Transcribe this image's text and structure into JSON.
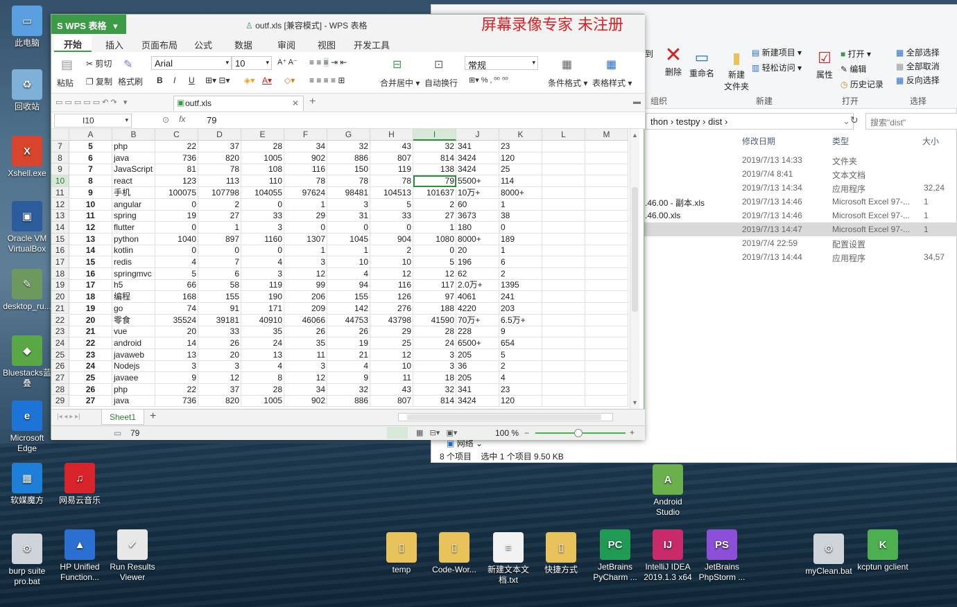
{
  "desktop": {
    "icons": [
      {
        "label": "此电脑",
        "color": "#5aa0e0",
        "glyph": "▭"
      },
      {
        "label": "回收站",
        "color": "#7fb0d8",
        "glyph": "♻"
      },
      {
        "label": "Xshell.exe",
        "color": "#d9442c",
        "glyph": "X"
      },
      {
        "label": "Oracle VM VirtualBox",
        "color": "#2b5d9c",
        "glyph": "▣"
      },
      {
        "label": "desktop_ru...",
        "color": "#6c9a5e",
        "glyph": "✎"
      },
      {
        "label": "Bluestacks蓝叠",
        "color": "#5aa845",
        "glyph": "◆"
      },
      {
        "label": "Microsoft Edge",
        "color": "#1b74d6",
        "glyph": "e"
      },
      {
        "label": "软媒魔方",
        "color": "#1e7fd8",
        "glyph": "▦"
      },
      {
        "label": "网易云音乐",
        "color": "#d8232a",
        "glyph": "♫"
      },
      {
        "label": "burp suite pro.bat",
        "color": "#cfd4da",
        "glyph": "⚙"
      },
      {
        "label": "HP Unified Function...",
        "color": "#2a6fd1",
        "glyph": "▲"
      },
      {
        "label": "Run Results Viewer",
        "color": "#e8e8e8",
        "glyph": "✔"
      },
      {
        "label": "temp",
        "color": "#e8c25a",
        "glyph": "▯"
      },
      {
        "label": "Code-Wor...",
        "color": "#e8c25a",
        "glyph": "▯"
      },
      {
        "label": "新建文本文档.txt",
        "color": "#f2f2f2",
        "glyph": "≡"
      },
      {
        "label": "快捷方式",
        "color": "#e8c25a",
        "glyph": "▯"
      },
      {
        "label": "JetBrains PyCharm ...",
        "color": "#1f9b53",
        "glyph": "PC"
      },
      {
        "label": "IntelliJ IDEA 2019.1.3 x64",
        "color": "#c92a69",
        "glyph": "IJ"
      },
      {
        "label": "JetBrains PhpStorm ...",
        "color": "#8b4fd8",
        "glyph": "PS"
      },
      {
        "label": "Android Studio",
        "color": "#6ab04c",
        "glyph": "A"
      },
      {
        "label": "myClean.bat",
        "color": "#cfd4da",
        "glyph": "⚙"
      },
      {
        "label": "kcptun gclient",
        "color": "#4caf50",
        "glyph": "K"
      }
    ]
  },
  "explorer": {
    "ribbon": {
      "move_to": "到",
      "delete": "删除",
      "rename": "重命名",
      "new_folder": "新建\n文件夹",
      "new_item": "新建项目",
      "easy_access": "轻松访问",
      "properties": "属性",
      "open": "打开",
      "edit": "编辑",
      "history": "历史记录",
      "select_all": "全部选择",
      "select_none": "全部取消",
      "invert": "反向选择",
      "groups": {
        "organize": "组织",
        "new": "新建",
        "open": "打开",
        "select": "选择"
      }
    },
    "address": {
      "parts": [
        "thon",
        "testpy",
        "dist"
      ]
    },
    "search_placeholder": "搜索\"dist\"",
    "columns": {
      "date": "修改日期",
      "type": "类型",
      "size": "大小"
    },
    "files": [
      {
        "name": "",
        "date": "2019/7/13 14:33",
        "type": "文件夹",
        "size": ""
      },
      {
        "name": "",
        "date": "2019/7/4 8:41",
        "type": "文本文档",
        "size": ""
      },
      {
        "name": "",
        "date": "2019/7/13 14:34",
        "type": "应用程序",
        "size": "32,24"
      },
      {
        "name": ".46.00 - 副本.xls",
        "date": "2019/7/13 14:46",
        "type": "Microsoft Excel 97-...",
        "size": "1"
      },
      {
        "name": ".46.00.xls",
        "date": "2019/7/13 14:46",
        "type": "Microsoft Excel 97-...",
        "size": "1"
      },
      {
        "name": "",
        "date": "2019/7/13 14:47",
        "type": "Microsoft Excel 97-...",
        "size": "1"
      },
      {
        "name": "",
        "date": "2019/7/4 22:59",
        "type": "配置设置",
        "size": ""
      },
      {
        "name": "",
        "date": "2019/7/13 14:44",
        "type": "应用程序",
        "size": "34,57"
      }
    ],
    "nav_network": "网络",
    "status": {
      "count": "8 个项目",
      "selected": "选中 1 个项目  9.50 KB"
    }
  },
  "wps": {
    "app_name": "WPS 表格",
    "title": "outf.xls [兼容模式] - WPS 表格",
    "watermark": "屏幕录像专家  未注册",
    "menus": [
      "开始",
      "插入",
      "页面布局",
      "公式",
      "数据",
      "审阅",
      "视图",
      "开发工具"
    ],
    "toolbar": {
      "cut": "剪切",
      "paste": "粘贴",
      "copy": "复制",
      "format_painter": "格式刷",
      "font": "Arial",
      "size": "10",
      "merge": "合并居中",
      "wrap": "自动换行",
      "number_format": "常规",
      "cond_format": "条件格式",
      "table_style": "表格样式"
    },
    "doc_tab": "outf.xls",
    "name_box": "I10",
    "fx": "fx",
    "formula_value": "79",
    "columns": [
      "A",
      "B",
      "C",
      "D",
      "E",
      "F",
      "G",
      "H",
      "I",
      "J",
      "K",
      "L",
      "M"
    ],
    "rows": [
      {
        "r": "7",
        "c": [
          "5",
          "php",
          "22",
          "37",
          "28",
          "34",
          "32",
          "43",
          "32",
          "341",
          "23"
        ]
      },
      {
        "r": "8",
        "c": [
          "6",
          "java",
          "736",
          "820",
          "1005",
          "902",
          "886",
          "807",
          "814",
          "3424",
          "120"
        ]
      },
      {
        "r": "9",
        "c": [
          "7",
          "JavaScript",
          "81",
          "78",
          "108",
          "116",
          "150",
          "119",
          "138",
          "3424",
          "25"
        ]
      },
      {
        "r": "10",
        "c": [
          "8",
          "react",
          "123",
          "113",
          "110",
          "78",
          "78",
          "78",
          "79",
          "5500+",
          "114"
        ]
      },
      {
        "r": "11",
        "c": [
          "9",
          "手机",
          "100075",
          "107798",
          "104055",
          "97624",
          "98481",
          "104513",
          "101637",
          "10万+",
          "8000+"
        ]
      },
      {
        "r": "12",
        "c": [
          "10",
          "angular",
          "0",
          "2",
          "0",
          "1",
          "3",
          "5",
          "2",
          "60",
          "1"
        ]
      },
      {
        "r": "13",
        "c": [
          "11",
          "spring",
          "19",
          "27",
          "33",
          "29",
          "31",
          "33",
          "27",
          "3673",
          "38"
        ]
      },
      {
        "r": "14",
        "c": [
          "12",
          "flutter",
          "0",
          "1",
          "3",
          "0",
          "0",
          "0",
          "1",
          "180",
          "0"
        ]
      },
      {
        "r": "15",
        "c": [
          "13",
          "python",
          "1040",
          "897",
          "1160",
          "1307",
          "1045",
          "904",
          "1080",
          "8000+",
          "189"
        ]
      },
      {
        "r": "16",
        "c": [
          "14",
          "kotlin",
          "0",
          "0",
          "0",
          "1",
          "1",
          "2",
          "0",
          "20",
          "1"
        ]
      },
      {
        "r": "17",
        "c": [
          "15",
          "redis",
          "4",
          "7",
          "4",
          "3",
          "10",
          "10",
          "5",
          "196",
          "6"
        ]
      },
      {
        "r": "18",
        "c": [
          "16",
          "springmvc",
          "5",
          "6",
          "3",
          "12",
          "4",
          "12",
          "12",
          "62",
          "2"
        ]
      },
      {
        "r": "19",
        "c": [
          "17",
          "h5",
          "66",
          "58",
          "119",
          "99",
          "94",
          "116",
          "117",
          "2.0万+",
          "1395"
        ]
      },
      {
        "r": "20",
        "c": [
          "18",
          "编程",
          "168",
          "155",
          "190",
          "206",
          "155",
          "126",
          "97",
          "4061",
          "241"
        ]
      },
      {
        "r": "21",
        "c": [
          "19",
          "go",
          "74",
          "91",
          "171",
          "209",
          "142",
          "276",
          "188",
          "4220",
          "203"
        ]
      },
      {
        "r": "22",
        "c": [
          "20",
          "零食",
          "35524",
          "39181",
          "40910",
          "46066",
          "44753",
          "43798",
          "41590",
          "70万+",
          "6.5万+"
        ]
      },
      {
        "r": "23",
        "c": [
          "21",
          "vue",
          "20",
          "33",
          "35",
          "26",
          "26",
          "29",
          "28",
          "228",
          "9"
        ]
      },
      {
        "r": "24",
        "c": [
          "22",
          "android",
          "14",
          "26",
          "24",
          "35",
          "19",
          "25",
          "24",
          "6500+",
          "654"
        ]
      },
      {
        "r": "25",
        "c": [
          "23",
          "javaweb",
          "13",
          "20",
          "13",
          "11",
          "21",
          "12",
          "3",
          "205",
          "5"
        ]
      },
      {
        "r": "26",
        "c": [
          "24",
          "Nodejs",
          "3",
          "3",
          "4",
          "3",
          "4",
          "10",
          "3",
          "36",
          "2"
        ]
      },
      {
        "r": "27",
        "c": [
          "25",
          "javaee",
          "9",
          "12",
          "8",
          "12",
          "9",
          "11",
          "18",
          "205",
          "4"
        ]
      },
      {
        "r": "28",
        "c": [
          "26",
          "php",
          "22",
          "37",
          "28",
          "34",
          "32",
          "43",
          "32",
          "341",
          "23"
        ]
      },
      {
        "r": "29",
        "c": [
          "27",
          "java",
          "736",
          "820",
          "1005",
          "902",
          "886",
          "807",
          "814",
          "3424",
          "120"
        ]
      }
    ],
    "sheet": "Sheet1",
    "status": {
      "value": "79",
      "zoom": "100 %"
    },
    "accent": "#3d9b48"
  }
}
